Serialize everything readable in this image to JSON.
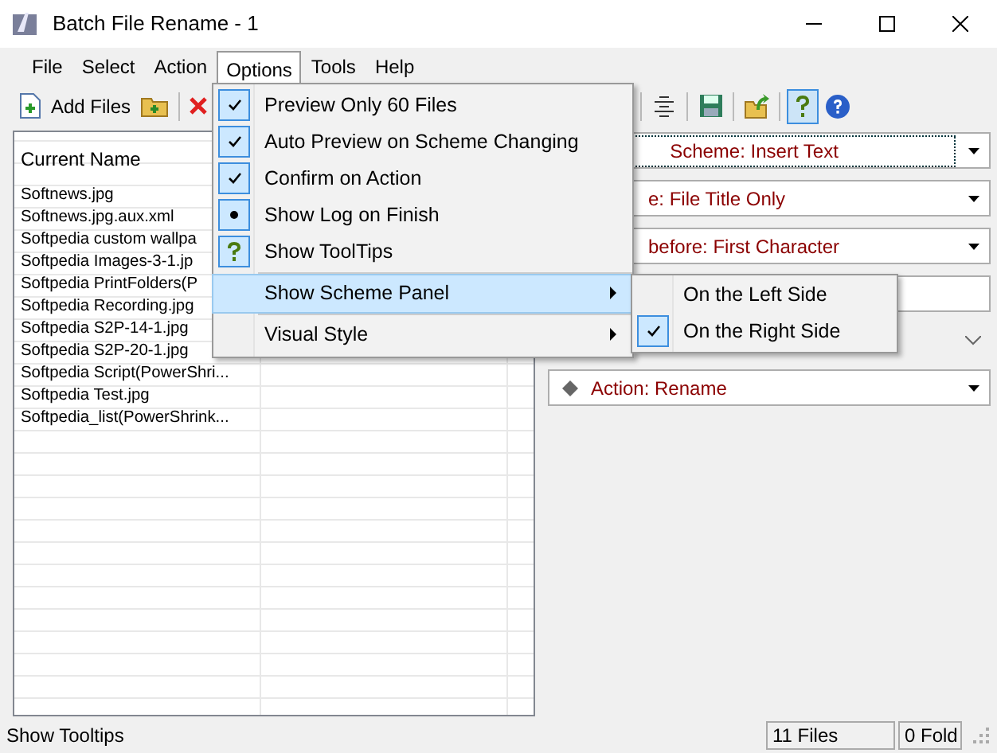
{
  "window": {
    "title": "Batch File Rename - 1"
  },
  "menu_bar": [
    {
      "label": "File",
      "selected": false
    },
    {
      "label": "Select",
      "selected": false
    },
    {
      "label": "Action",
      "selected": false
    },
    {
      "label": "Options",
      "selected": true
    },
    {
      "label": "Tools",
      "selected": false
    },
    {
      "label": "Help",
      "selected": false
    }
  ],
  "toolbar": {
    "add_files_label": "Add Files",
    "help_pressed": true
  },
  "file_list": {
    "columns": [
      "Current Name"
    ],
    "rows": [
      "Softnews.jpg",
      "Softnews.jpg.aux.xml",
      "Softpedia custom wallpa",
      "Softpedia Images-3-1.jp",
      "Softpedia PrintFolders(P",
      "Softpedia Recording.jpg",
      "Softpedia S2P-14-1.jpg",
      "Softpedia S2P-20-1.jpg",
      "Softpedia Script(PowerShri...",
      "Softpedia Test.jpg",
      "Softpedia_list(PowerShrink..."
    ]
  },
  "scheme_panel": [
    {
      "kind": "dropdown",
      "text": "Scheme: Insert Text",
      "focused": true
    },
    {
      "kind": "dropdown",
      "text": "e: File Title Only",
      "focused": false
    },
    {
      "kind": "dropdown",
      "text": "before: First Character",
      "focused": false
    },
    {
      "kind": "textbox"
    },
    {
      "kind": "flat-dropdown"
    },
    {
      "kind": "action",
      "text": "Action: Rename",
      "focused": false
    }
  ],
  "options_menu": [
    {
      "label": "Preview Only 60 Files",
      "kind": "check",
      "checked": true,
      "selected": false,
      "separator_before": false
    },
    {
      "label": "Auto Preview on Scheme Changing",
      "kind": "check",
      "checked": true,
      "selected": false,
      "separator_before": false
    },
    {
      "label": "Confirm on Action",
      "kind": "check",
      "checked": true,
      "selected": false,
      "separator_before": false
    },
    {
      "label": "Show Log on Finish",
      "kind": "bullet",
      "checked": true,
      "selected": false,
      "separator_before": false
    },
    {
      "label": "Show ToolTips",
      "kind": "help",
      "checked": true,
      "selected": false,
      "separator_before": false
    },
    {
      "label": "Show Scheme Panel",
      "kind": "submenu",
      "selected": true,
      "separator_before": true
    },
    {
      "label": "Visual Style",
      "kind": "submenu",
      "selected": false,
      "separator_before": true
    }
  ],
  "submenu": [
    {
      "label": "On the Left Side",
      "checked": false,
      "selected": false
    },
    {
      "label": "On the Right Side",
      "checked": true,
      "selected": false
    }
  ],
  "status_bar": {
    "message": "Show Tooltips",
    "panels": [
      "11 Files",
      "0 Fold"
    ]
  }
}
